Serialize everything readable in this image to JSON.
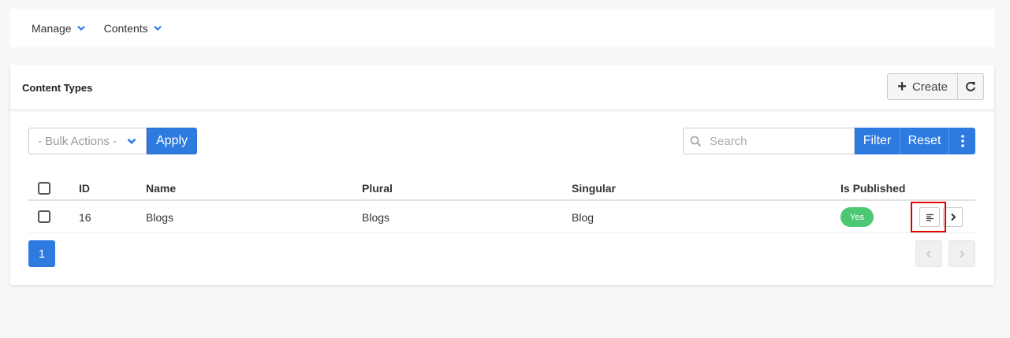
{
  "nav": {
    "manage": "Manage",
    "contents": "Contents"
  },
  "panel": {
    "title": "Content Types",
    "create_label": "Create"
  },
  "toolbar": {
    "bulk_actions": "- Bulk Actions -",
    "apply": "Apply",
    "search_placeholder": "Search",
    "filter": "Filter",
    "reset": "Reset"
  },
  "table": {
    "columns": {
      "id": "ID",
      "name": "Name",
      "plural": "Plural",
      "singular": "Singular",
      "published": "Is Published"
    },
    "rows": [
      {
        "id": "16",
        "name": "Blogs",
        "plural": "Blogs",
        "singular": "Blog",
        "published": "Yes"
      }
    ]
  },
  "pagination": {
    "current": "1"
  },
  "colors": {
    "primary": "#2d7be0",
    "success": "#4cc774",
    "highlight": "#e00000"
  },
  "icons": [
    "chevron-down-icon",
    "plus-icon",
    "refresh-icon",
    "search-icon",
    "more-vertical-icon",
    "list-icon",
    "chevron-right-icon",
    "chevron-left-icon"
  ]
}
